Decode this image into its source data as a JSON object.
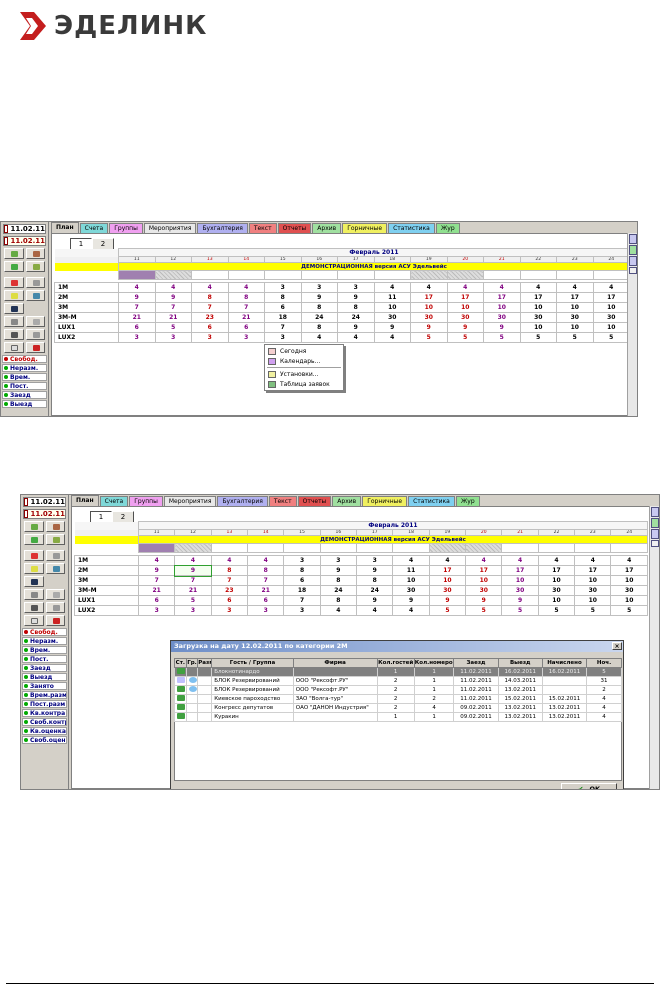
{
  "logo": {
    "text": "ЭДЕЛИНК"
  },
  "left_panel": {
    "dates": [
      "11.02.11",
      "11.02.11"
    ],
    "legend_short": [
      "Свобод.",
      "Неразм.",
      "Врем.",
      "Пост.",
      "Заезд",
      "Выезд"
    ],
    "legend_full": [
      "Свобод.",
      "Неразм.",
      "Врем.",
      "Пост.",
      "Заезд",
      "Выезд",
      "Занято",
      "Врем.разм",
      "Пост.разм",
      "Кв.контра",
      "Своб.контр",
      "Кв.оценка",
      "Своб.оцен"
    ]
  },
  "tabs": [
    {
      "label": "План",
      "color": "#d4d0c8"
    },
    {
      "label": "Счета",
      "color": "#7fd8d8"
    },
    {
      "label": "Группы",
      "color": "#f0a0f0"
    },
    {
      "label": "Мероприятия",
      "color": "#e8e8e8"
    },
    {
      "label": "Бухгалтерия",
      "color": "#b0b0f0"
    },
    {
      "label": "Текст",
      "color": "#f08080"
    },
    {
      "label": "Отчеты",
      "color": "#e05050"
    },
    {
      "label": "Архив",
      "color": "#a0e0a0"
    },
    {
      "label": "Горничные",
      "color": "#f0f060"
    },
    {
      "label": "Статистика",
      "color": "#7fd0f0"
    },
    {
      "label": "Жур",
      "color": "#90e090"
    }
  ],
  "pages": [
    "1",
    "2"
  ],
  "plan": {
    "month": "Февраль 2011",
    "demo_banner": "ДЕМОНСТРАЦИОННАЯ версия АСУ Эдельвейс",
    "days": [
      "11",
      "12",
      "13",
      "14",
      "15",
      "16",
      "17",
      "18",
      "19",
      "20",
      "21",
      "22",
      "23",
      "24"
    ],
    "rows": [
      {
        "cat": "1М",
        "vals": [
          "4",
          "4",
          "4",
          "4",
          "3",
          "3",
          "3",
          "4",
          "4",
          "4",
          "4",
          "4",
          "4",
          "4"
        ]
      },
      {
        "cat": "2М",
        "vals": [
          "9",
          "9",
          "8",
          "8",
          "8",
          "9",
          "9",
          "11",
          "17",
          "17",
          "17",
          "17",
          "17",
          "17"
        ]
      },
      {
        "cat": "3М",
        "vals": [
          "7",
          "7",
          "7",
          "7",
          "6",
          "8",
          "8",
          "10",
          "10",
          "10",
          "10",
          "10",
          "10",
          "10"
        ]
      },
      {
        "cat": "3М-М",
        "vals": [
          "21",
          "21",
          "23",
          "21",
          "18",
          "24",
          "24",
          "30",
          "30",
          "30",
          "30",
          "30",
          "30",
          "30"
        ]
      },
      {
        "cat": "LUX1",
        "vals": [
          "6",
          "5",
          "6",
          "6",
          "7",
          "8",
          "9",
          "9",
          "9",
          "9",
          "9",
          "10",
          "10",
          "10"
        ]
      },
      {
        "cat": "LUX2",
        "vals": [
          "3",
          "3",
          "3",
          "3",
          "3",
          "4",
          "4",
          "4",
          "5",
          "5",
          "5",
          "5",
          "5",
          "5"
        ]
      }
    ]
  },
  "context_menu": {
    "items": [
      "Сегодня",
      "Календарь...",
      "Установки...",
      "Таблица заявок"
    ]
  },
  "dialog": {
    "title": "Загрузка на дату 12.02.2011 по категории 2М",
    "close": "×",
    "columns": [
      "Ст.",
      "Гр.",
      "Разм",
      "Гость / Группа",
      "Фирма",
      "Кол.гостей",
      "Кол.номеров",
      "Заезд",
      "Выезд",
      "Начислено",
      "Ноч."
    ],
    "rows": [
      [
        "",
        "",
        "",
        "Блокнотинардо",
        "",
        "1",
        "1",
        "11.02.2011",
        "16.02.2011",
        "16.02.2011",
        "5"
      ],
      [
        "",
        "",
        "",
        "БЛОК Резервирований",
        "ООО \"Рексофт.РУ\"",
        "2",
        "1",
        "11.02.2011",
        "14.03.2011",
        "",
        "31"
      ],
      [
        "",
        "",
        "",
        "БЛОК Резервирований",
        "ООО \"Рексофт.РУ\"",
        "2",
        "1",
        "11.02.2011",
        "13.02.2011",
        "",
        "2"
      ],
      [
        "",
        "",
        "",
        "Киевское пароходство",
        "ЗАО \"Волга-тур\"",
        "2",
        "2",
        "11.02.2011",
        "15.02.2011",
        "15.02.2011",
        "4"
      ],
      [
        "",
        "",
        "",
        "Конгресс депутатов",
        "ОАО \"ДАНОН Индустрия\"",
        "2",
        "4",
        "09.02.2011",
        "13.02.2011",
        "13.02.2011",
        "4"
      ],
      [
        "",
        "",
        "",
        "Куракин",
        "",
        "1",
        "1",
        "09.02.2011",
        "13.02.2011",
        "13.02.2011",
        "4"
      ]
    ],
    "ok": "OK"
  },
  "colors": {
    "accent_red": "#c00000",
    "value_purple": "#800080",
    "banner": "#ffff00"
  }
}
